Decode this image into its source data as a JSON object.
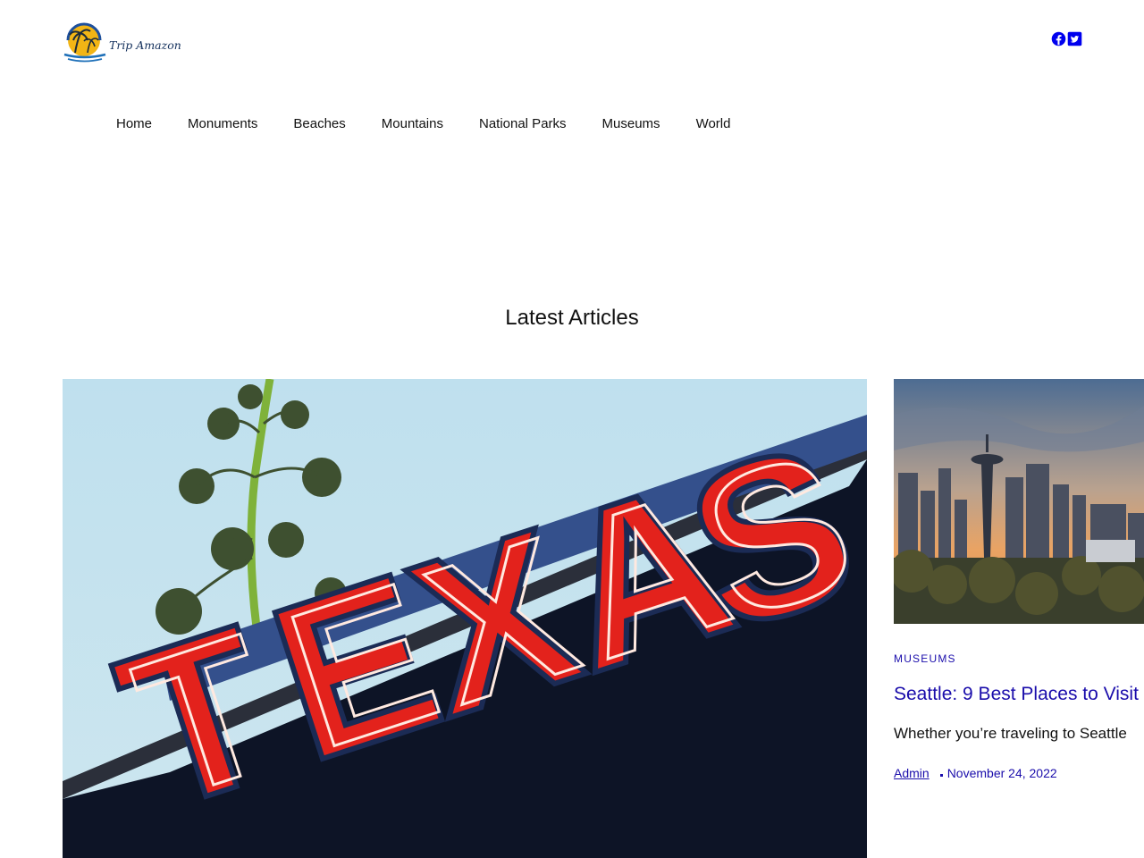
{
  "brand": {
    "logo_text": "Trip Amazon"
  },
  "social": {
    "icons": [
      "facebook-icon",
      "twitter-icon"
    ],
    "color": "#0000ee"
  },
  "nav": {
    "items": [
      {
        "label": "Home"
      },
      {
        "label": "Monuments"
      },
      {
        "label": "Beaches"
      },
      {
        "label": "Mountains"
      },
      {
        "label": "National Parks"
      },
      {
        "label": "Museums"
      },
      {
        "label": "World"
      }
    ]
  },
  "latest": {
    "heading": "Latest Articles",
    "featured": {
      "image_sign_text": "TEXAS"
    },
    "cards": [
      {
        "category": "MUSEUMS",
        "title": "Seattle: 9 Best Places to Visit",
        "excerpt": "Whether you’re traveling to Seattle",
        "author": "Admin",
        "date": "November 24, 2022"
      }
    ]
  },
  "colors": {
    "link": "#1a0dab",
    "text": "#111111",
    "background": "#ffffff"
  }
}
